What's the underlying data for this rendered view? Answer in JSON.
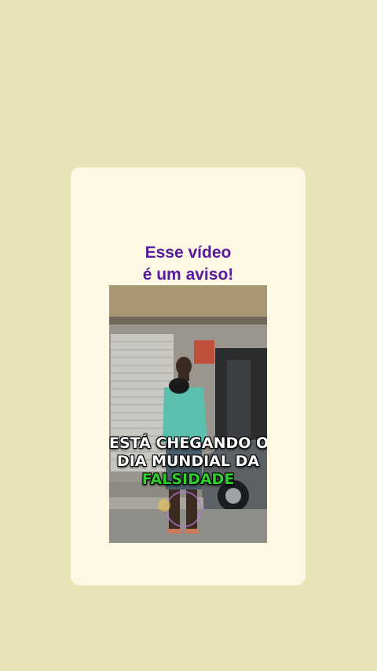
{
  "post": {
    "caption_line1": "Esse vídeo",
    "caption_line2": "é um aviso!"
  },
  "video": {
    "subtitle_line1": "ESTÁ CHEGANDO O",
    "subtitle_line2": "DIA MUNDIAL DA",
    "subtitle_highlight": "FALSIDADE"
  },
  "colors": {
    "background": "#e8e4b8",
    "card": "#fdf8e3",
    "caption": "#5a1a9c",
    "highlight": "#2fd12f"
  }
}
